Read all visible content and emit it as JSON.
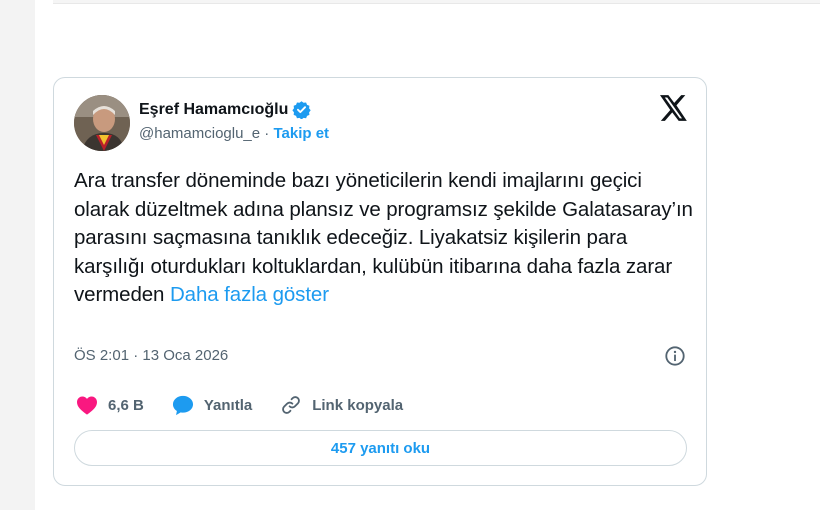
{
  "tweet": {
    "author_name": "Eşref Hamamcıoğlu",
    "handle": "@hamamcioglu_e",
    "separator": " · ",
    "follow_label": "Takip et",
    "text": "Ara transfer döneminde bazı yöneticilerin kendi imajlarını geçici olarak düzeltmek adına plansız ve programsız şekilde Galatasaray’ın parasını saçmasına tanıklık edeceğiz. Liyakatsiz kişilerin para karşılığı oturdukları koltuklardan, kulübün itibarına daha fazla zarar vermeden ",
    "show_more_label": "Daha fazla göster",
    "timestamp": "ÖS 2:01 · 13 Oca 2026",
    "likes_count": "6,6 B",
    "reply_label": "Yanıtla",
    "copy_link_label": "Link kopyala",
    "read_replies_label": "457 yanıtı oku"
  },
  "icons": {
    "verified": "verified-badge-icon",
    "brand": "x-logo-icon",
    "info": "info-icon",
    "like": "heart-icon",
    "reply": "speech-bubble-icon",
    "link": "link-icon"
  },
  "colors": {
    "accent": "#1d9bf0",
    "like": "#f91880",
    "text": "#0f1419",
    "muted": "#536471",
    "border": "#cfd9de"
  }
}
